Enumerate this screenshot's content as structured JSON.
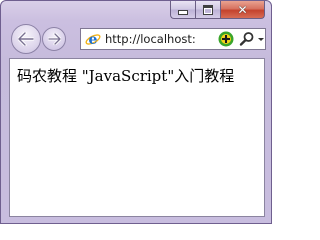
{
  "window": {
    "controls": {
      "minimize_icon": "minimize-icon",
      "maximize_icon": "maximize-icon",
      "close_icon": "close-icon",
      "close_color": "#c94a34"
    }
  },
  "nav": {
    "back_icon": "back-arrow-icon",
    "forward_icon": "forward-arrow-icon"
  },
  "address_bar": {
    "url": "http://localhost:",
    "page_icon": "ie-icon",
    "compat_icon": "compatibility-view-icon",
    "search_icon": "search-icon",
    "dropdown_icon": "chevron-down-icon"
  },
  "content": {
    "text": "码农教程 \"JavaScript\"入门教程"
  },
  "colors": {
    "frame": "#c8bddf",
    "content_bg": "#ffffff",
    "ie_blue": "#1c6fd1",
    "compat_green": "#3aa52a",
    "compat_yellow": "#f2d21a"
  }
}
